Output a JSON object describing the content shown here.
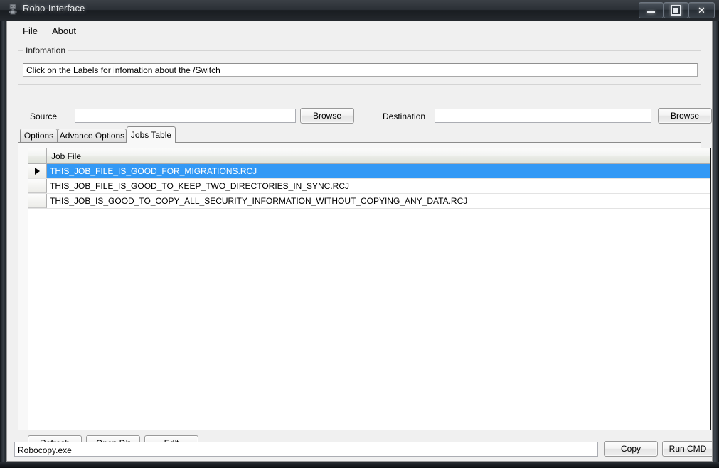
{
  "window": {
    "title": "Robo-Interface",
    "icon": "robot-icon",
    "caption_buttons": {
      "minimize": "minimize-icon",
      "maximize": "maximize-icon",
      "close": "✕"
    }
  },
  "menu": {
    "items": [
      {
        "label": "File"
      },
      {
        "label": "About"
      }
    ]
  },
  "information": {
    "legend": "Infomation",
    "text": "Click on the Labels for infomation about the /Switch"
  },
  "paths": {
    "source": {
      "label": "Source",
      "value": "",
      "placeholder": "",
      "browse_label": "Browse"
    },
    "destination": {
      "label": "Destination",
      "value": "",
      "placeholder": "",
      "browse_label": "Browse"
    }
  },
  "tabs": [
    {
      "label": "Options",
      "active": false
    },
    {
      "label": "Advance Options",
      "active": false
    },
    {
      "label": "Jobs Table",
      "active": true
    }
  ],
  "jobs_table": {
    "columns": [
      "Job File"
    ],
    "rows": [
      {
        "job_file": "THIS_JOB_FILE_IS_GOOD_FOR_MIGRATIONS.RCJ",
        "selected": true
      },
      {
        "job_file": "THIS_JOB_FILE_IS_GOOD_TO_KEEP_TWO_DIRECTORIES_IN_SYNC.RCJ",
        "selected": false
      },
      {
        "job_file": "THIS_JOB_IS_GOOD_TO_COPY_ALL_SECURITY_INFORMATION_WITHOUT_COPYING_ANY_DATA.RCJ",
        "selected": false
      }
    ],
    "selection_color": "#3399f5"
  },
  "grid_buttons": {
    "refresh": "Refresh",
    "open_dir": "Open Dir",
    "edit": "Edit"
  },
  "command_bar": {
    "value": "Robocopy.exe",
    "placeholder": "",
    "copy_label": "Copy",
    "run_label": "Run CMD"
  }
}
